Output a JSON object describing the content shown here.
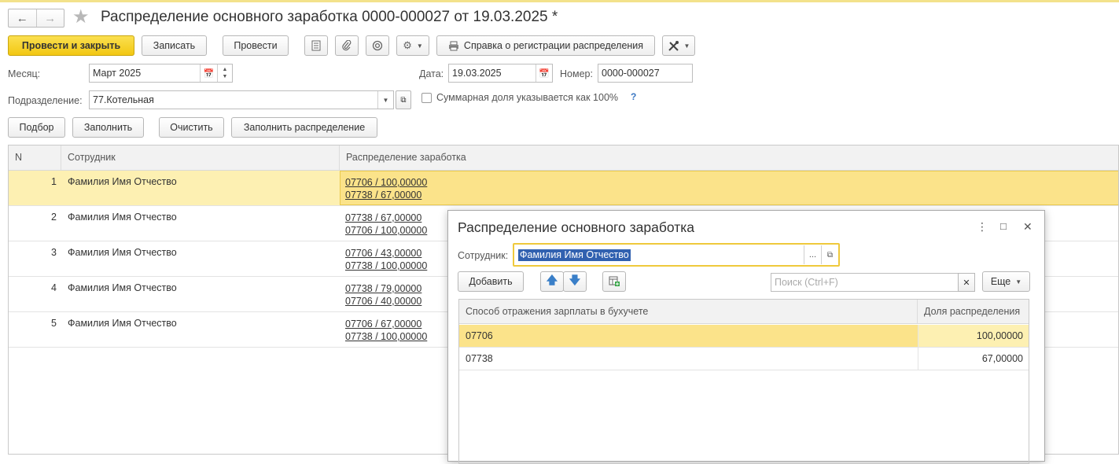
{
  "header": {
    "back_icon": "arrow-left-icon",
    "forward_icon": "arrow-right-icon",
    "favorite_icon": "star-icon",
    "title": "Распределение основного заработка 0000-000027 от 19.03.2025 *"
  },
  "toolbar": {
    "post_close": "Провести и закрыть",
    "save": "Записать",
    "post": "Провести",
    "report_button": "Справка о регистрации распределения"
  },
  "form": {
    "month_label": "Месяц:",
    "month_value": "Март 2025",
    "date_label": "Дата:",
    "date_value": "19.03.2025",
    "number_label": "Номер:",
    "number_value": "0000-000027",
    "dept_label": "Подразделение:",
    "dept_value": "77.Котельная",
    "sum_share_label": "Суммарная доля указывается как 100%",
    "help": "?"
  },
  "actions": {
    "pick": "Подбор",
    "fill": "Заполнить",
    "clear": "Очистить",
    "fill_dist": "Заполнить распределение"
  },
  "table": {
    "columns": [
      "N",
      "Сотрудник",
      "Распределение заработка"
    ],
    "rows": [
      {
        "n": "1",
        "employee": "Фамилия Имя Отчество",
        "d1": "07706 / 100,00000",
        "d2": "07738 / 67,00000"
      },
      {
        "n": "2",
        "employee": "Фамилия Имя Отчество",
        "d1": "07738 / 67,00000",
        "d2": "07706 / 100,00000"
      },
      {
        "n": "3",
        "employee": "Фамилия Имя Отчество",
        "d1": "07706 / 43,00000",
        "d2": "07738 / 100,00000"
      },
      {
        "n": "4",
        "employee": "Фамилия Имя Отчество",
        "d1": "07738 / 79,00000",
        "d2": "07706 / 40,00000"
      },
      {
        "n": "5",
        "employee": "Фамилия Имя Отчество",
        "d1": "07706 / 67,00000",
        "d2": "07738 / 100,00000"
      }
    ]
  },
  "modal": {
    "title": "Распределение основного заработка",
    "employee_label": "Сотрудник:",
    "employee_value": "Фамилия Имя Отчество",
    "add": "Добавить",
    "search_placeholder": "Поиск (Ctrl+F)",
    "more": "Еще",
    "columns": [
      "Способ отражения зарплаты в бухучете",
      "Доля распределения"
    ],
    "rows": [
      {
        "method": "07706",
        "share": "100,00000"
      },
      {
        "method": "07738",
        "share": "67,00000"
      }
    ]
  }
}
